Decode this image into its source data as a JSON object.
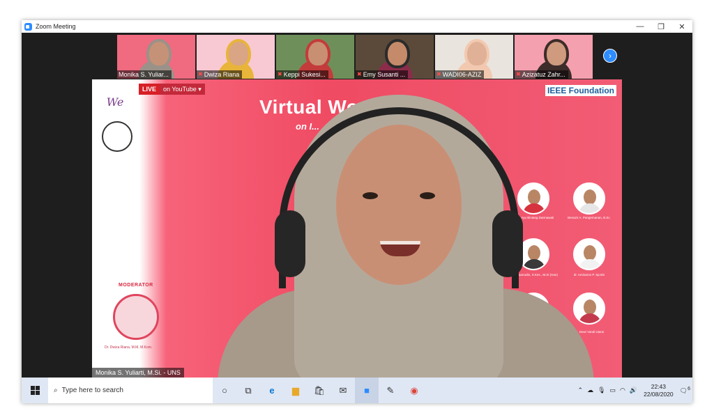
{
  "window": {
    "title": "Zoom Meeting",
    "minimize": "—",
    "maximize": "❐",
    "close": "✕"
  },
  "participants": [
    {
      "name": "Monika S. Yuliar...",
      "bg": "#f06a80",
      "hijab": "#9a9288",
      "muted": false
    },
    {
      "name": "Dwiza Riana",
      "bg": "#f8c9d3",
      "hijab": "#e8b43a",
      "muted": true
    },
    {
      "name": "Keppi Sukesi...",
      "bg": "#6f8f5a",
      "hijab": "#c43b3b",
      "muted": true
    },
    {
      "name": "Emy Susanti ...",
      "bg": "#5b4a3a",
      "hijab": "#2b2b2b",
      "muted": true
    },
    {
      "name": "WADI06-AZIZ",
      "bg": "#e9e4dd",
      "hijab": "#f2c9b0",
      "muted": true
    },
    {
      "name": "Azizatuz Zahr...",
      "bg": "#f5a0ae",
      "hijab": "#3d2c2a",
      "muted": true
    }
  ],
  "next_icon": "chevron-right-icon",
  "main_video": {
    "live_label": "LIVE",
    "youtube_label": "on YouTube ▾",
    "slide_title": "Virtual Workshop",
    "slide_subtitle": "on I...",
    "ieee_label": "IEEE Foundation",
    "logo_text": "We",
    "moderator_label": "MODERATOR",
    "moderator_name": "Dr. Dwiza Riana, M.M, M.Kom.",
    "speakers": [
      {
        "name": "Gusti Ayu Bintang Darmawati"
      },
      {
        "name": "Benazir A. Pangemanan, B.Sc."
      },
      {
        "name": "Bilis Nisarrudin, S.Kes., M.Si (Han)"
      },
      {
        "name": "dr. Aminarno P. Sp.BS"
      },
      {
        "name": "...Haeni, M.Kes."
      },
      {
        "name": "Dr. Dewi Yandi Utami"
      }
    ],
    "speaker_name_overlay": "Monika S. Yuliarti, M.Si. - UNS"
  },
  "taskbar": {
    "search_placeholder": "Type here to search",
    "time": "22:43",
    "date": "22/08/2020",
    "notification_count": "6"
  }
}
